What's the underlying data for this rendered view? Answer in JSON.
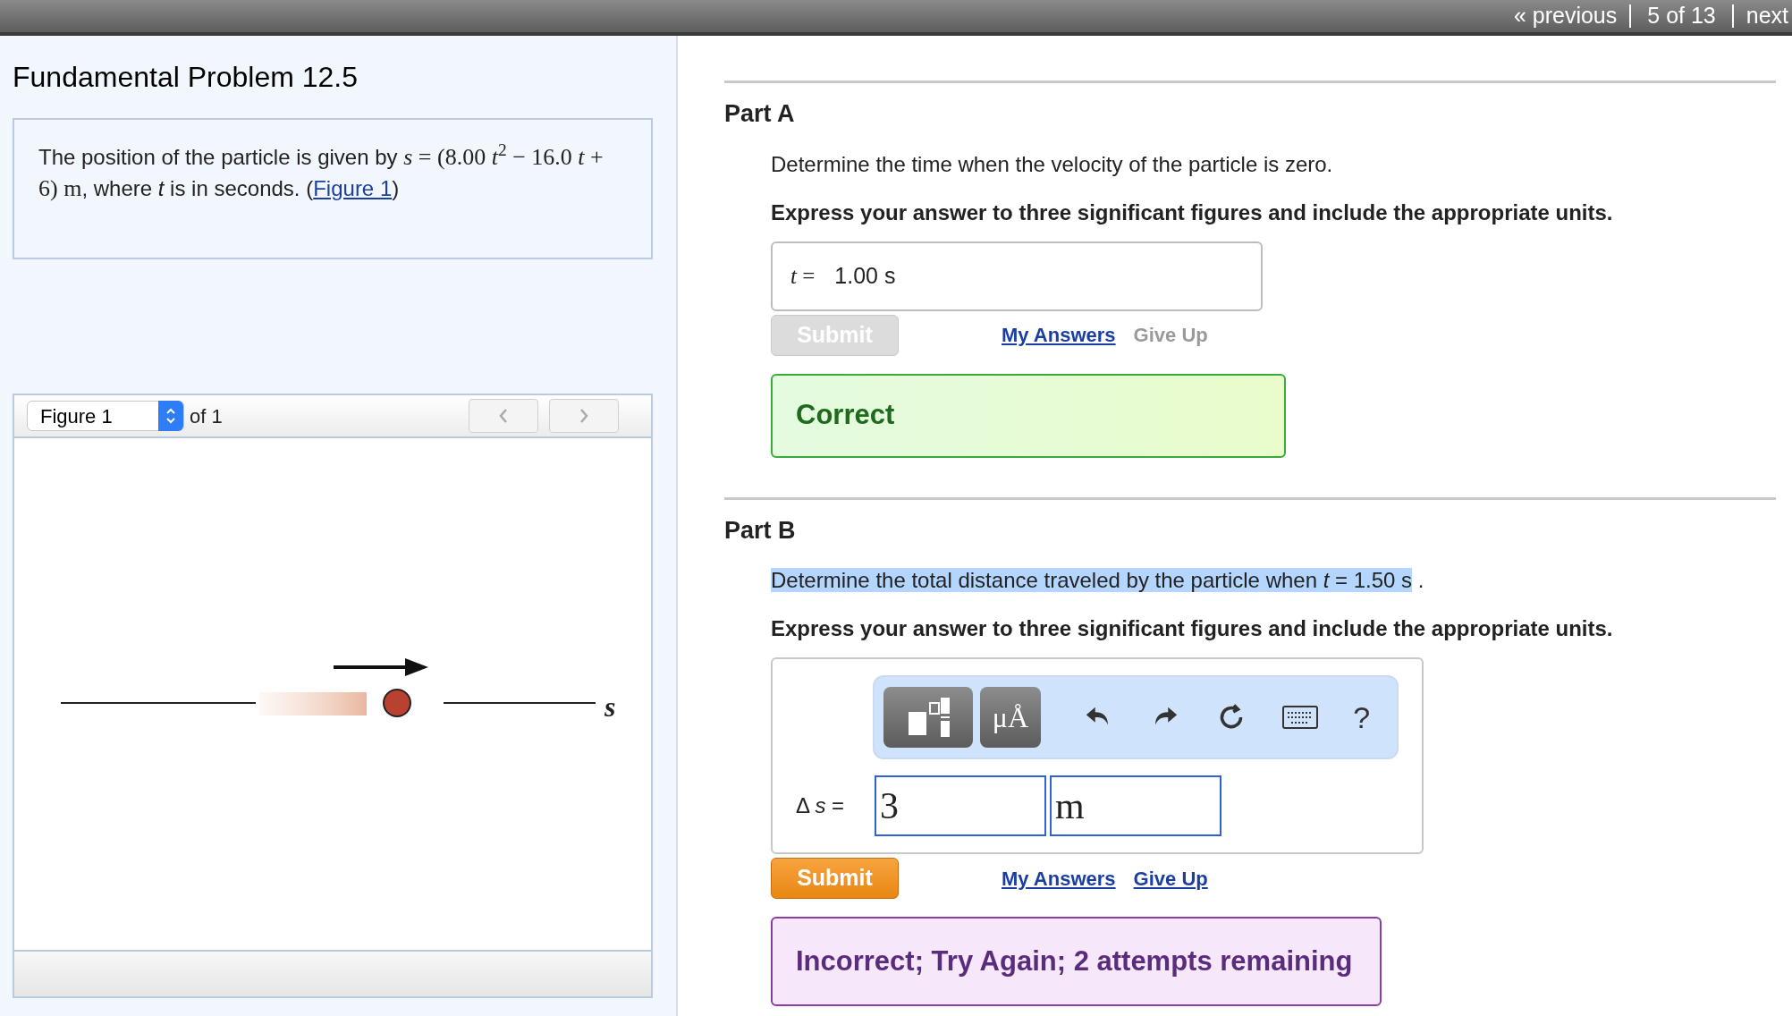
{
  "nav": {
    "previous": "« previous",
    "position": "5 of 13",
    "next": "next"
  },
  "problem": {
    "title": "Fundamental Problem 12.5",
    "text_before": "The position of the particle is given by",
    "equation": "*s* = (8.00 *t*$^{2}$ − 16.0 *t* + 6) m",
    "text_after": ", where *t* is in seconds.",
    "link_open": "(",
    "link": "Figure 1",
    "link_close": ")"
  },
  "figure": {
    "select": "Figure 1",
    "count": "of 1",
    "axis_label": "s"
  },
  "parts": [
    {
      "kind": "simple",
      "title": "Part A",
      "prompt": "Determine the time when the velocity of the particle is zero.",
      "highlighted": false,
      "instruction": "Express your answer to three significant figures and include the appropriate units.",
      "answer_label": "*t* =",
      "answer": "1.00 s",
      "submit": {
        "label": "Submit",
        "disabled": true
      },
      "my_answers": "My Answers",
      "give_up": {
        "label": "Give Up",
        "disabled": true
      },
      "feedback": {
        "kind": "correct",
        "text": "Correct"
      }
    },
    {
      "kind": "editor",
      "title": "Part B",
      "prompt": "Determine the total distance traveled by the particle when *t* = 1.50 s",
      "prompt_end": ".",
      "highlighted": true,
      "instruction": "Express your answer to three significant figures and include the appropriate units.",
      "toolbar": {
        "symbols": "μÅ",
        "help": "?"
      },
      "answer_label": "Δ *s* =",
      "value": "3",
      "unit": "m",
      "submit": {
        "label": "Submit",
        "disabled": false
      },
      "my_answers": "My Answers",
      "give_up": {
        "label": "Give Up",
        "disabled": false
      },
      "feedback": {
        "kind": "incorrect",
        "text": "Incorrect; Try Again; 2 attempts remaining"
      }
    }
  ]
}
